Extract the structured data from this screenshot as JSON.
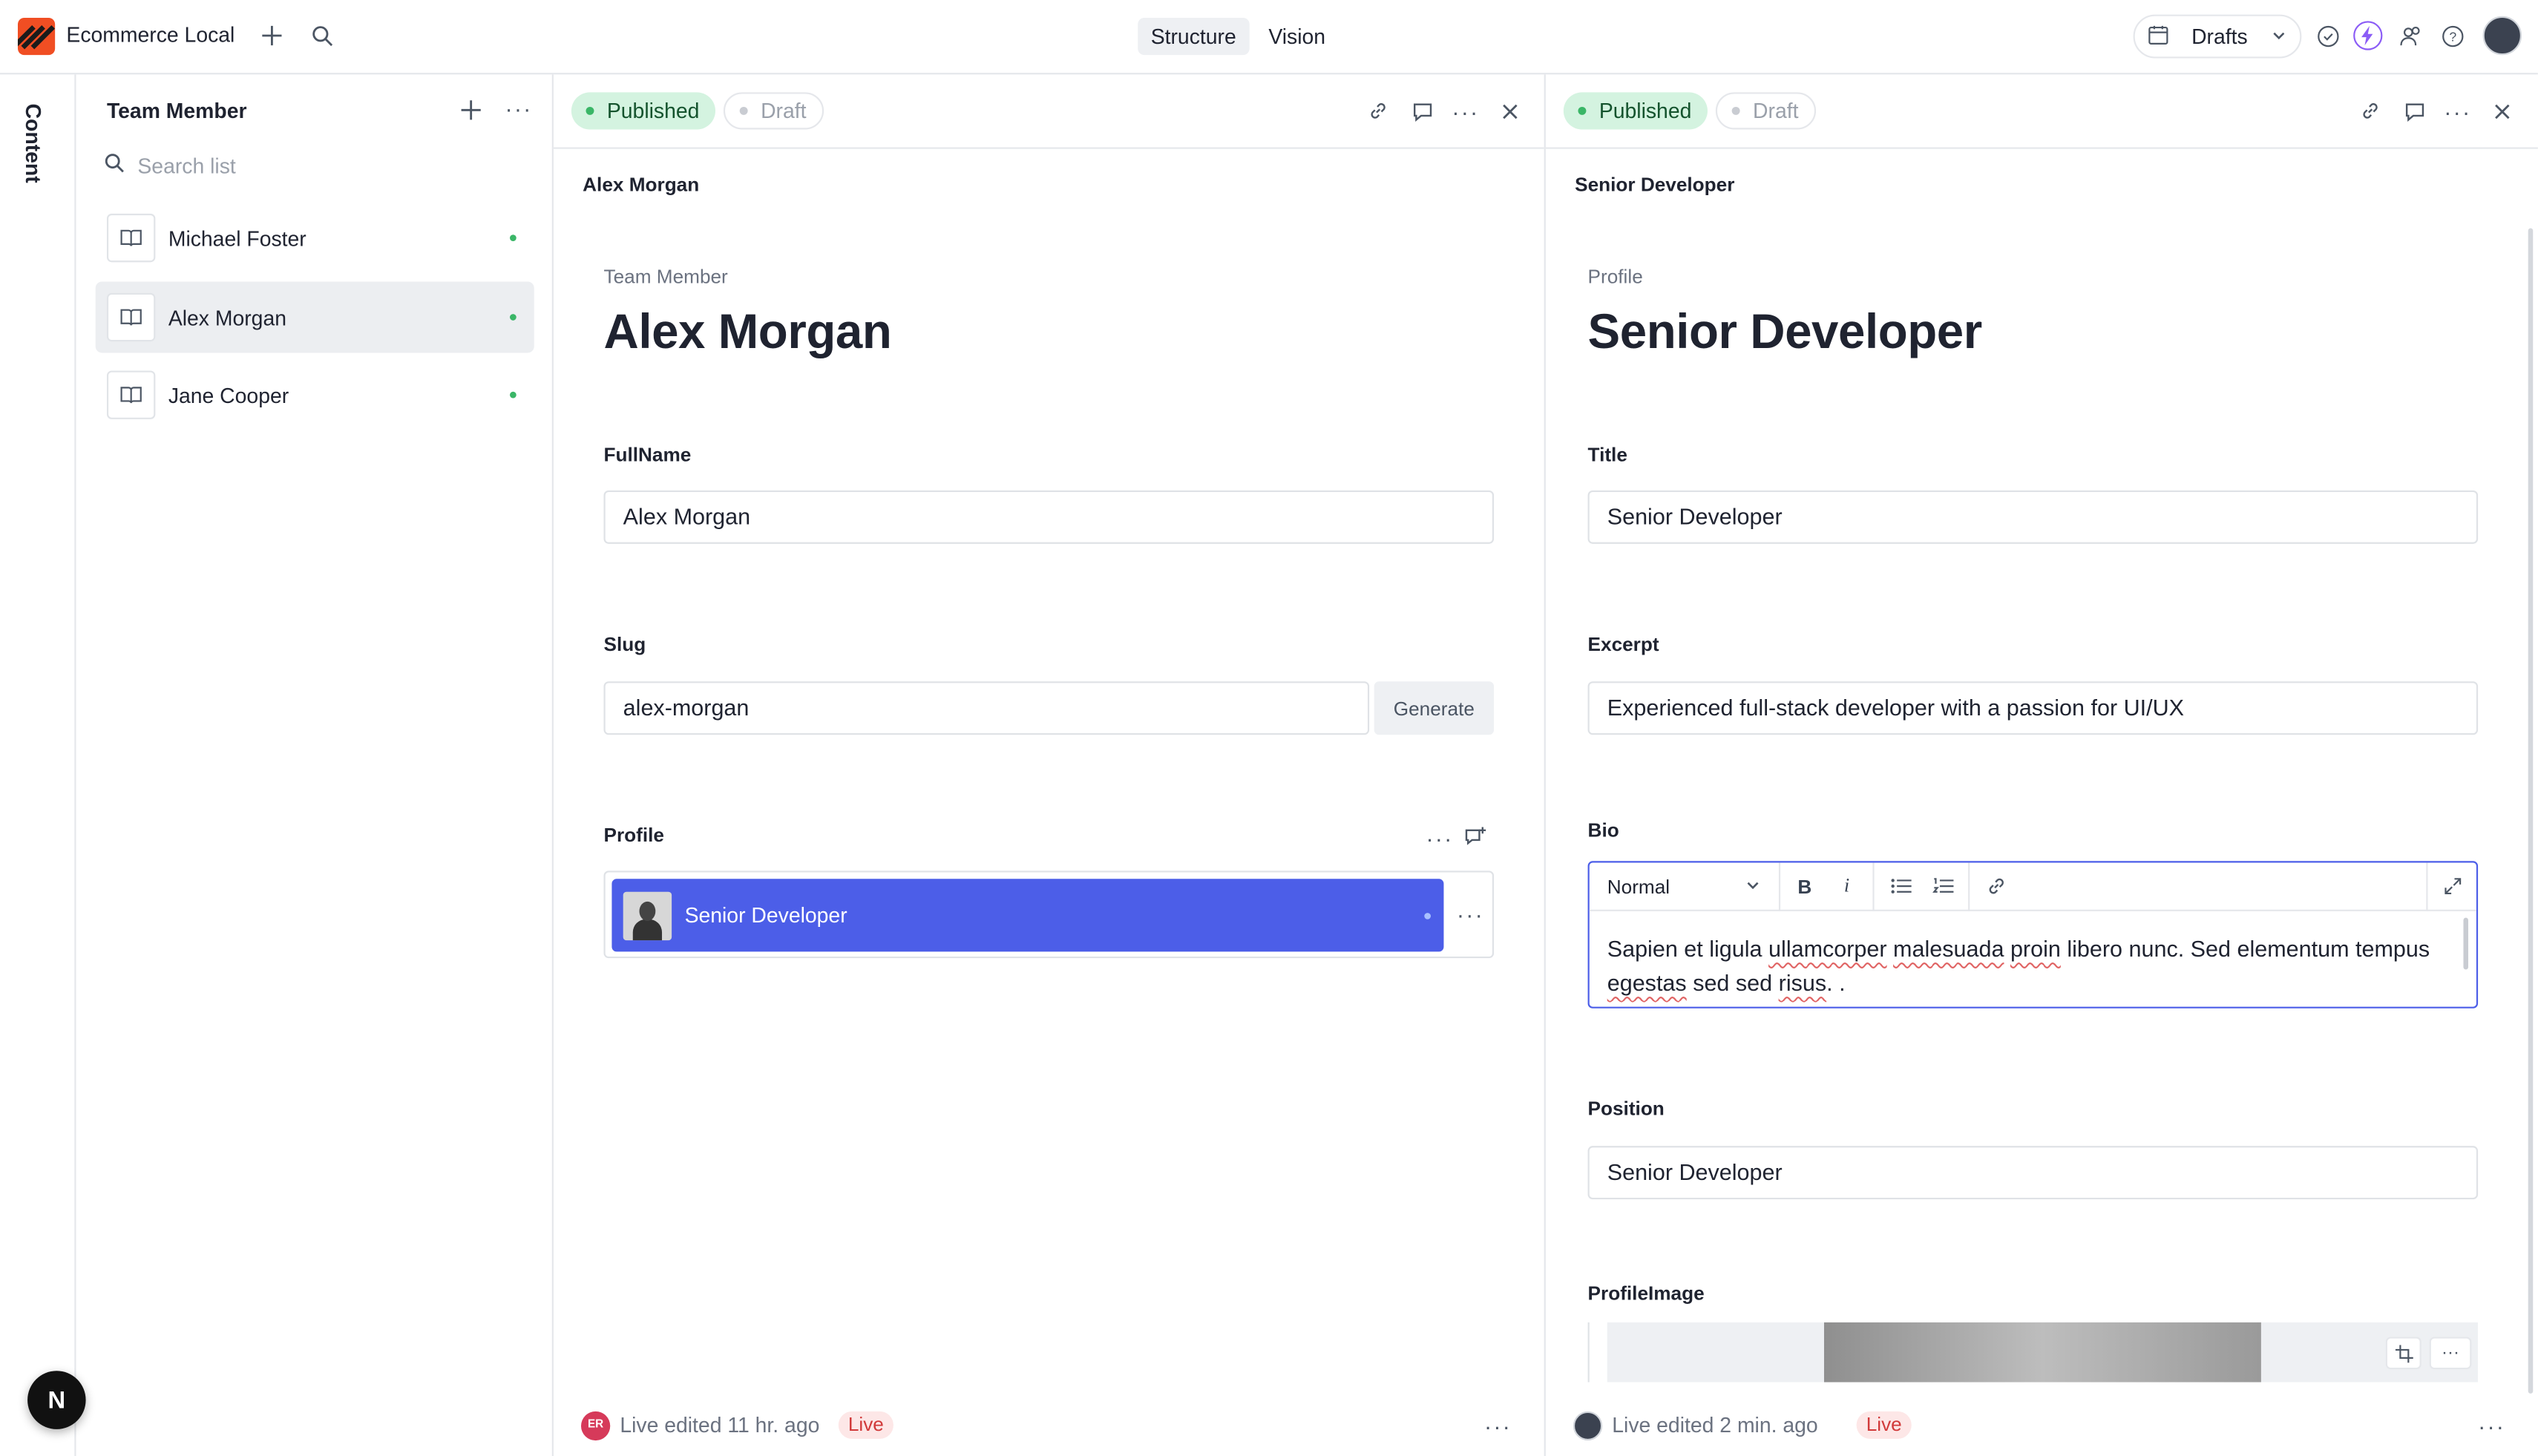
{
  "app": {
    "title": "Ecommerce Local"
  },
  "topbar": {
    "tabs": [
      "Structure",
      "Vision"
    ],
    "drafts_label": "Drafts"
  },
  "rail": {
    "label": "Content",
    "badge": "N"
  },
  "list": {
    "title": "Team Member",
    "search_placeholder": "Search list",
    "items": [
      {
        "label": "Michael Foster"
      },
      {
        "label": "Alex Morgan"
      },
      {
        "label": "Jane Cooper"
      }
    ]
  },
  "pane_a": {
    "status_published": "Published",
    "status_draft": "Draft",
    "breadcrumb": "Alex Morgan",
    "doc_type": "Team Member",
    "doc_title": "Alex Morgan",
    "fields": {
      "fullname_label": "FullName",
      "fullname_value": "Alex Morgan",
      "slug_label": "Slug",
      "slug_value": "alex-morgan",
      "generate_label": "Generate",
      "profile_label": "Profile",
      "profile_ref": "Senior Developer"
    },
    "footer": {
      "avatar_initials": "ER",
      "edited": "Live edited 11 hr. ago",
      "live": "Live"
    }
  },
  "pane_b": {
    "status_published": "Published",
    "status_draft": "Draft",
    "breadcrumb": "Senior Developer",
    "doc_type": "Profile",
    "doc_title": "Senior Developer",
    "fields": {
      "title_label": "Title",
      "title_value": "Senior Developer",
      "excerpt_label": "Excerpt",
      "excerpt_value": "Experienced full-stack developer with a passion for UI/UX",
      "bio_label": "Bio",
      "bio_style": "Normal",
      "bio_text_parts": [
        "Sapien et ligula ",
        "ullamcorper",
        " ",
        "malesuada",
        " ",
        "proin",
        " libero nunc. Sed elementum tempus ",
        "egestas",
        " sed sed ",
        "risus",
        ". ."
      ],
      "position_label": "Position",
      "position_value": "Senior Developer",
      "profileimage_label": "ProfileImage"
    },
    "footer": {
      "edited": "Live edited 2 min. ago",
      "live": "Live"
    }
  },
  "colors": {
    "brand": "#f04e23",
    "reference_card": "#4c5ee8",
    "published_bg": "#d4f3e0",
    "live_text": "#d13a3a",
    "status_dot": "#3ab667"
  }
}
